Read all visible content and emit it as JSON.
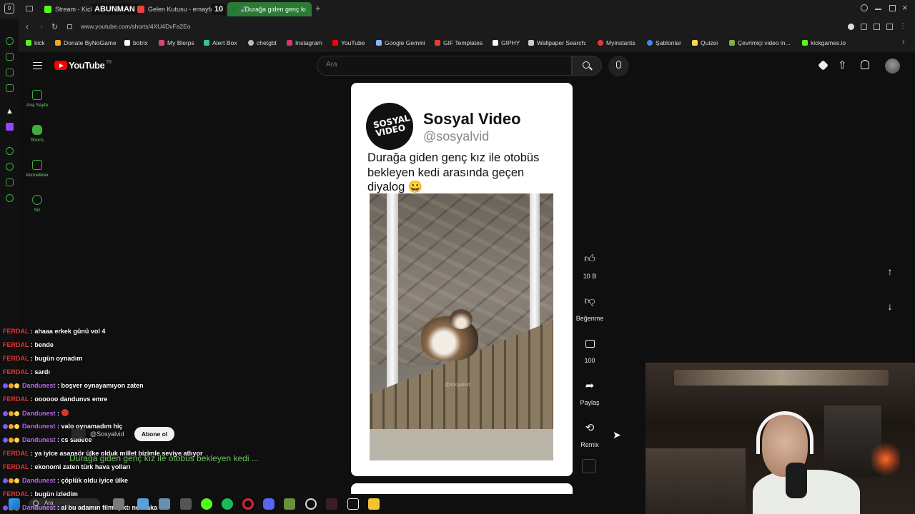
{
  "browser": {
    "tabs": [
      {
        "label": "Stream - Kick",
        "color": "#53fc18"
      },
      {
        "label": "Gelen Kutusu - emayfav",
        "color": "#ea4335"
      },
      {
        "label": "Durağa giden genç kı",
        "color": "#ff0000"
      }
    ],
    "overlay_tab_text": "ABUNMAN",
    "overlay_tab_count": "10",
    "tab_counter": "0",
    "url": "www.youtube.com/shorts/4XU4DvFa2Eo",
    "bookmarks": [
      {
        "label": "kick",
        "color": "#53fc18"
      },
      {
        "label": "Donate ByNoGame",
        "color": "#f5a623"
      },
      {
        "label": "botrix",
        "color": "#ffffff"
      },
      {
        "label": "My Blerps",
        "color": "#e0407a"
      },
      {
        "label": "Alert Box",
        "color": "#31c3a2"
      },
      {
        "label": "chetgbt",
        "color": "#bbbbbb"
      },
      {
        "label": "Instagram",
        "color": "#e1306c"
      },
      {
        "label": "YouTube",
        "color": "#ff0000"
      },
      {
        "label": "Google Gemini",
        "color": "#8ab4f8"
      },
      {
        "label": "GIF Templates",
        "color": "#e23b3b"
      },
      {
        "label": "GIPHY",
        "color": "#ffffff"
      },
      {
        "label": "Wallpaper Search:",
        "color": "#cccccc"
      },
      {
        "label": "Myinstants",
        "color": "#e23b3b"
      },
      {
        "label": "Şablonlar",
        "color": "#4285f4"
      },
      {
        "label": "Quizei",
        "color": "#ffd54f"
      },
      {
        "label": "Çevrimiçi video in...",
        "color": "#7cb342"
      },
      {
        "label": "kickgames.io",
        "color": "#53fc18"
      }
    ]
  },
  "youtube": {
    "logo_text": "YouTube",
    "region": "TR",
    "search_placeholder": "Ara",
    "guide": [
      {
        "label": "Ana Sayfa"
      },
      {
        "label": "Shorts"
      },
      {
        "label": "Abonelikler"
      },
      {
        "label": "Siz"
      }
    ],
    "short": {
      "channel_name": "Sosyal Video",
      "channel_handle": "@sosyalvid",
      "caption": "Durağa giden genç kız ile otobüs bekleyen kedi arasında geçen diyalog 😀",
      "logo_text": "SOSYAL VIDEO",
      "watermark": "@sosyalvid",
      "overlay_handle": "@Sosyalvid",
      "subscribe_label": "Abone ol",
      "overlay_title": "Durağa giden genç kız ile otobüs bekleyen kedi ..."
    },
    "actions": [
      {
        "label": "10 B",
        "icon": "like-icon"
      },
      {
        "label": "Beğenme",
        "icon": "dislike-icon"
      },
      {
        "label": "100",
        "icon": "comment-icon"
      },
      {
        "label": "Paylaş",
        "icon": "share-icon"
      },
      {
        "label": "Remix",
        "icon": "remix-icon"
      }
    ]
  },
  "chat": [
    {
      "user": "FERDAL",
      "msg": ": ahaaa erkek günü vol 4",
      "type": "ferdal"
    },
    {
      "user": "FERDAL",
      "msg": ": bende",
      "type": "ferdal"
    },
    {
      "user": "FERDAL",
      "msg": ": bugün oynadım",
      "type": "ferdal"
    },
    {
      "user": "FERDAL",
      "msg": ": sardı",
      "type": "ferdal"
    },
    {
      "user": "Dandunest",
      "msg": ": boşver oynayamıyon zaten",
      "type": "dand"
    },
    {
      "user": "FERDAL",
      "msg": ": oooooo dandunvs emre",
      "type": "ferdal"
    },
    {
      "user": "Dandunest",
      "msg": ":",
      "type": "dand"
    },
    {
      "user": "Dandunest",
      "msg": ": valo oynamadım hiç",
      "type": "dand"
    },
    {
      "user": "Dandunest",
      "msg": ": cs sadece",
      "type": "dand"
    },
    {
      "user": "FERDAL",
      "msg": ": ya iyice asansör ülke olduk millet bizimle seviye atlıyor",
      "type": "ferdal"
    },
    {
      "user": "FERDAL",
      "msg": ": ekonomi zaten türk hava yolları",
      "type": "ferdal"
    },
    {
      "user": "Dandunest",
      "msg": ": çöplük oldu iyice ülke",
      "type": "dand"
    },
    {
      "user": "FERDAL",
      "msg": ": bugün izledim",
      "type": "ferdal"
    },
    {
      "user": "Dandunest",
      "msg": ": al bu adamın filmi çıktı ne alaka",
      "type": "dand"
    }
  ],
  "taskbar": {
    "search_label": "Ara"
  }
}
